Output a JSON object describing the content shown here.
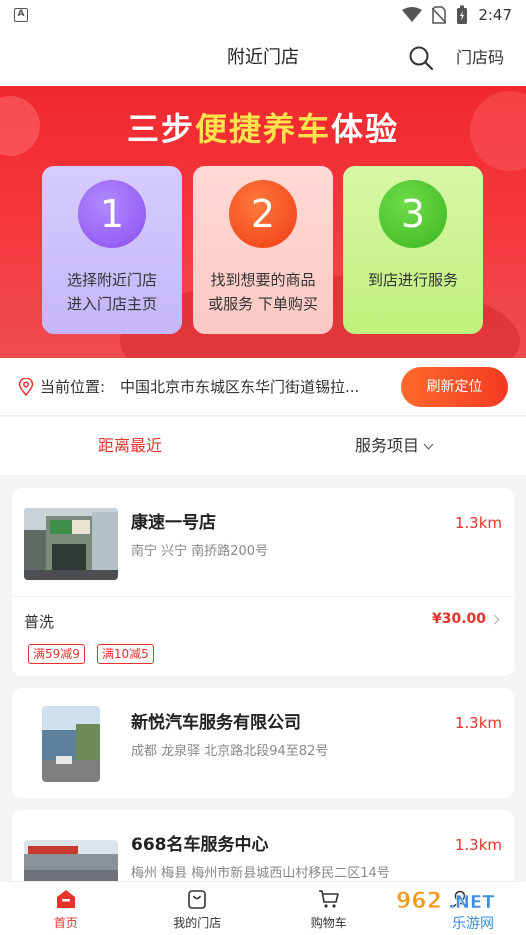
{
  "status": {
    "app_badge": "A",
    "time": "2:47"
  },
  "nav": {
    "title": "附近门店",
    "code_label": "门店码"
  },
  "banner": {
    "headline_pre": "三步",
    "headline_hl": "便捷养车",
    "headline_post": "体验",
    "steps": [
      {
        "num": "1",
        "line1": "选择附近门店",
        "line2": "进入门店主页"
      },
      {
        "num": "2",
        "line1": "找到想要的商品",
        "line2": "或服务 下单购买"
      },
      {
        "num": "3",
        "line1": "到店进行服务",
        "line2": ""
      }
    ]
  },
  "location": {
    "label": "当前位置:",
    "address": "中国北京市东城区东华门街道锡拉...",
    "refresh_label": "刷新定位"
  },
  "filters": {
    "distance": "距离最近",
    "service": "服务项目"
  },
  "stores": [
    {
      "name": "康速一号店",
      "address": "南宁 兴宁 南挢路200号",
      "distance": "1.3km",
      "service": "普洗",
      "price": "¥30.00",
      "coupons": [
        "满59减9",
        "满10减5"
      ]
    },
    {
      "name": "新悦汽车服务有限公司",
      "address": "成都 龙泉驿 北京路北段94至82号",
      "distance": "1.3km"
    },
    {
      "name": "668名车服务中心",
      "address": "梅州 梅县 梅州市新县城西山村移民二区14号",
      "distance": "1.3km"
    }
  ],
  "tabs": [
    {
      "label": "首页",
      "icon": "home-icon"
    },
    {
      "label": "我的门店",
      "icon": "store-bag-icon"
    },
    {
      "label": "购物车",
      "icon": "cart-icon"
    },
    {
      "label": "",
      "icon": "profile-icon"
    }
  ],
  "watermark": {
    "text": "962.NET",
    "subtext": "乐游网"
  },
  "colors": {
    "accent": "#e8332d",
    "banner_red": "#f0282e",
    "highlight_yellow": "#ffe34d"
  }
}
